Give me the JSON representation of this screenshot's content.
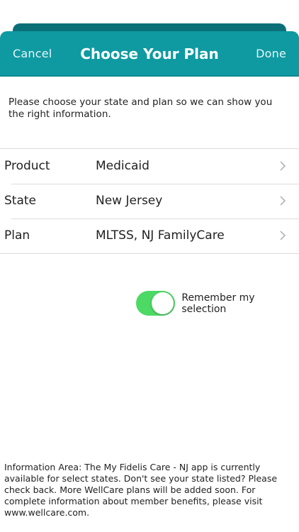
{
  "nav": {
    "cancel_label": "Cancel",
    "title": "Choose Your Plan",
    "done_label": "Done"
  },
  "intro_text": "Please choose your state and plan so we can show you the right information.",
  "rows": [
    {
      "label": "Product",
      "value": "Medicaid"
    },
    {
      "label": "State",
      "value": "New Jersey"
    },
    {
      "label": "Plan",
      "value": "MLTSS, NJ FamilyCare"
    }
  ],
  "remember": {
    "label": "Remember my selection",
    "on": true
  },
  "info_text": "Information Area: The My Fidelis Care - NJ app is currently available for select states. Don't see your state listed? Please check back. More WellCare plans will be added soon. For complete information about member benefits, please visit www.wellcare.com.",
  "colors": {
    "nav_bg": "#0f9aa2",
    "toggle_on": "#4cd964"
  },
  "icons": {
    "row_disclosure": "chevron-right-icon"
  }
}
